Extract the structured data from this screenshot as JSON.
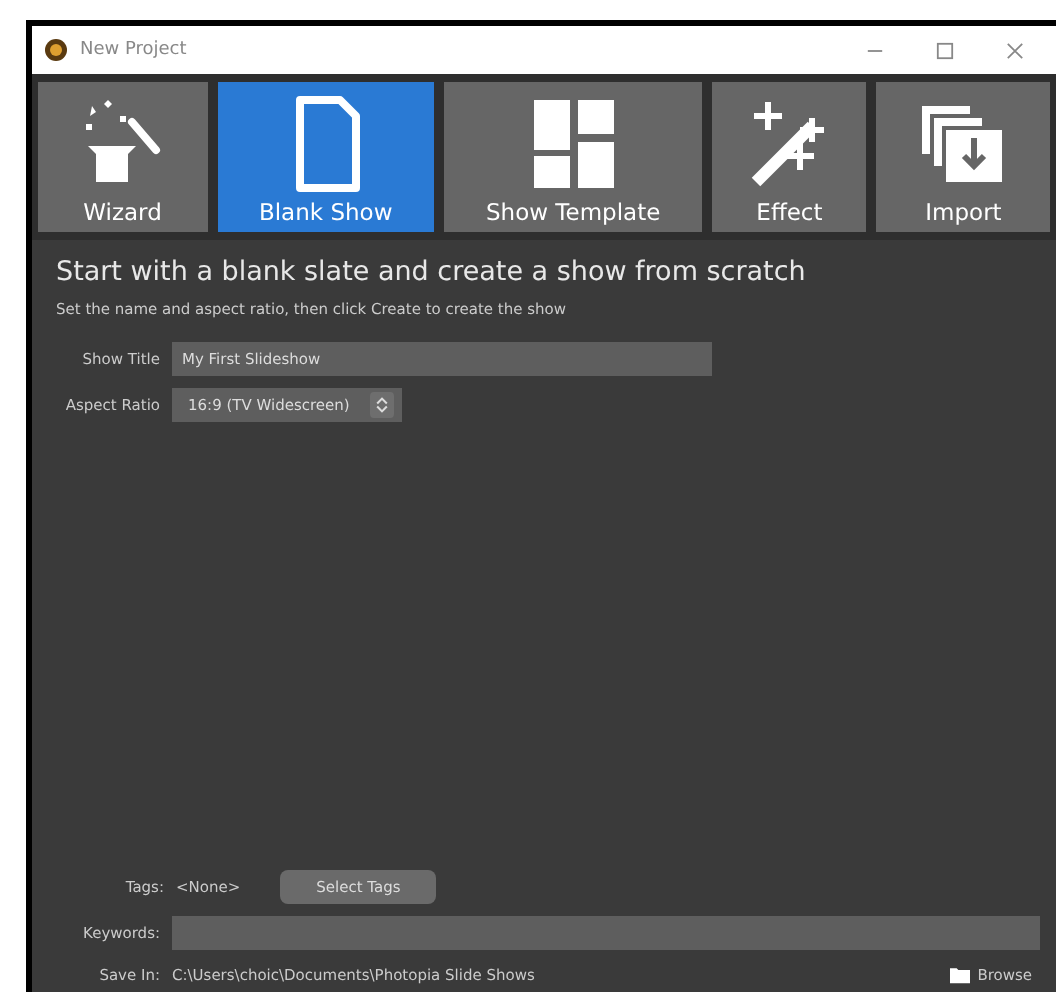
{
  "window": {
    "title": "New Project"
  },
  "tabs": [
    {
      "label": "Wizard",
      "kind": "wizard",
      "selected": false
    },
    {
      "label": "Blank Show",
      "kind": "blank",
      "selected": true
    },
    {
      "label": "Show Template",
      "kind": "template",
      "selected": false
    },
    {
      "label": "Effect",
      "kind": "effect",
      "selected": false
    },
    {
      "label": "Import",
      "kind": "import",
      "selected": false
    }
  ],
  "heading": "Start with a blank slate and create a show from scratch",
  "subheading": "Set the name and aspect ratio, then click Create to create the show",
  "show_title": {
    "label": "Show Title",
    "value": "My First Slideshow"
  },
  "aspect_ratio": {
    "label": "Aspect Ratio",
    "value": "16:9 (TV Widescreen)"
  },
  "tags": {
    "label": "Tags:",
    "value": "<None>",
    "button": "Select Tags"
  },
  "keywords": {
    "label": "Keywords:"
  },
  "save_in": {
    "label": "Save In:",
    "path": "C:\\Users\\choic\\Documents\\Photopia Slide Shows",
    "button": "Browse"
  }
}
